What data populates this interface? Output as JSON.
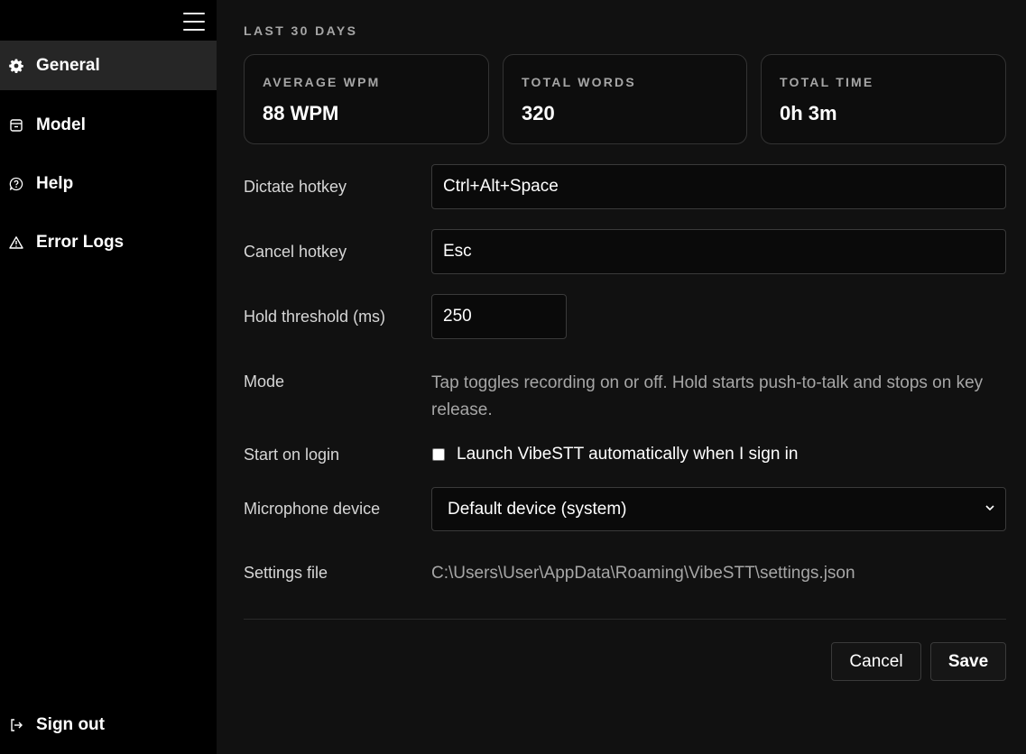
{
  "sidebar": {
    "menu_icon": "hamburger-menu-icon",
    "items": [
      {
        "label": "General",
        "icon": "gear-icon",
        "active": true
      },
      {
        "label": "Model",
        "icon": "box-icon",
        "active": false
      },
      {
        "label": "Help",
        "icon": "help-bubble-icon",
        "active": false
      },
      {
        "label": "Error Logs",
        "icon": "warning-triangle-icon",
        "active": false
      }
    ],
    "sign_out": {
      "label": "Sign out",
      "icon": "sign-out-icon"
    }
  },
  "stats": {
    "section_title": "LAST 30 DAYS",
    "cards": [
      {
        "label": "AVERAGE WPM",
        "value": "88 WPM"
      },
      {
        "label": "TOTAL WORDS",
        "value": "320"
      },
      {
        "label": "TOTAL TIME",
        "value": "0h 3m"
      }
    ]
  },
  "settings": {
    "dictate_hotkey": {
      "label": "Dictate hotkey",
      "value": "Ctrl+Alt+Space"
    },
    "cancel_hotkey": {
      "label": "Cancel hotkey",
      "value": "Esc"
    },
    "hold_threshold": {
      "label": "Hold threshold (ms)",
      "value": "250"
    },
    "mode": {
      "label": "Mode",
      "text": "Tap toggles recording on or off. Hold starts push-to-talk and stops on key release."
    },
    "start_on_login": {
      "label": "Start on login",
      "checkbox_label": "Launch VibeSTT automatically when I sign in",
      "checked": false
    },
    "microphone": {
      "label": "Microphone device",
      "selected": "Default device (system)"
    },
    "settings_file": {
      "label": "Settings file",
      "path": "C:\\Users\\User\\AppData\\Roaming\\VibeSTT\\settings.json"
    }
  },
  "actions": {
    "cancel_label": "Cancel",
    "save_label": "Save"
  },
  "colors": {
    "background": "#111111",
    "sidebar": "#000000",
    "active_item": "#262626",
    "muted_text": "#a6a6a6"
  }
}
